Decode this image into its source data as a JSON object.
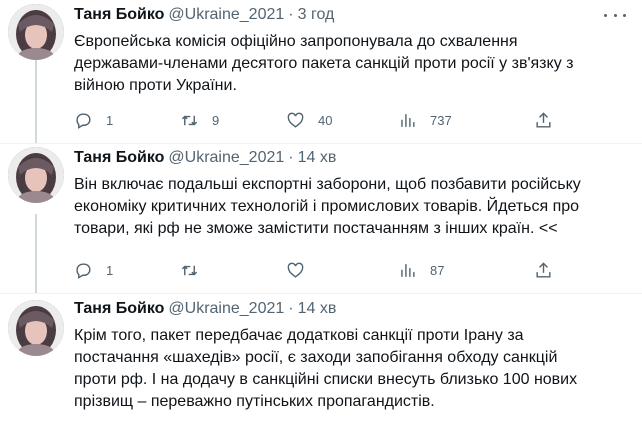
{
  "tweets": [
    {
      "author": "Таня Бойко",
      "handle": "@Ukraine_2021",
      "separator": "·",
      "time": "3 год",
      "text": "Європейська комісія офіційно запропонувала до схвалення\nдержавами-членами десятого пакета санкцій проти росії у зв'язку з\nвійною проти України.",
      "replies": "1",
      "retweets": "9",
      "likes": "40",
      "views": "737"
    },
    {
      "author": "Таня Бойко",
      "handle": "@Ukraine_2021",
      "separator": "·",
      "time": "14 хв",
      "text": "Він включає подальші експортні заборони, щоб позбавити російську\nекономіку критичних технологій і промислових товарів. Йдеться про\nтовари, які рф не зможе замістити постачанням з інших країн. <<",
      "replies": "1",
      "retweets": "",
      "likes": "",
      "views": "87"
    },
    {
      "author": "Таня Бойко",
      "handle": "@Ukraine_2021",
      "separator": "·",
      "time": "14 хв",
      "text": "Крім того, пакет передбачає додаткові санкції проти Ірану за\nпостачання «шахедів» росії, є заходи запобігання обходу санкцій\nпроти рф. І на додачу в санкційні списки внесуть близько 100 нових\nпрізвищ – переважно путінських пропагандистів."
    }
  ],
  "icons": {
    "reply": "reply-icon",
    "retweet": "retweet-icon",
    "like": "like-icon",
    "views": "views-icon",
    "share": "share-icon",
    "more": "more-icon"
  },
  "colors": {
    "text": "#0f1419",
    "secondary": "#536471",
    "divider": "#eff3f4",
    "thread_line": "#cfd9de"
  }
}
